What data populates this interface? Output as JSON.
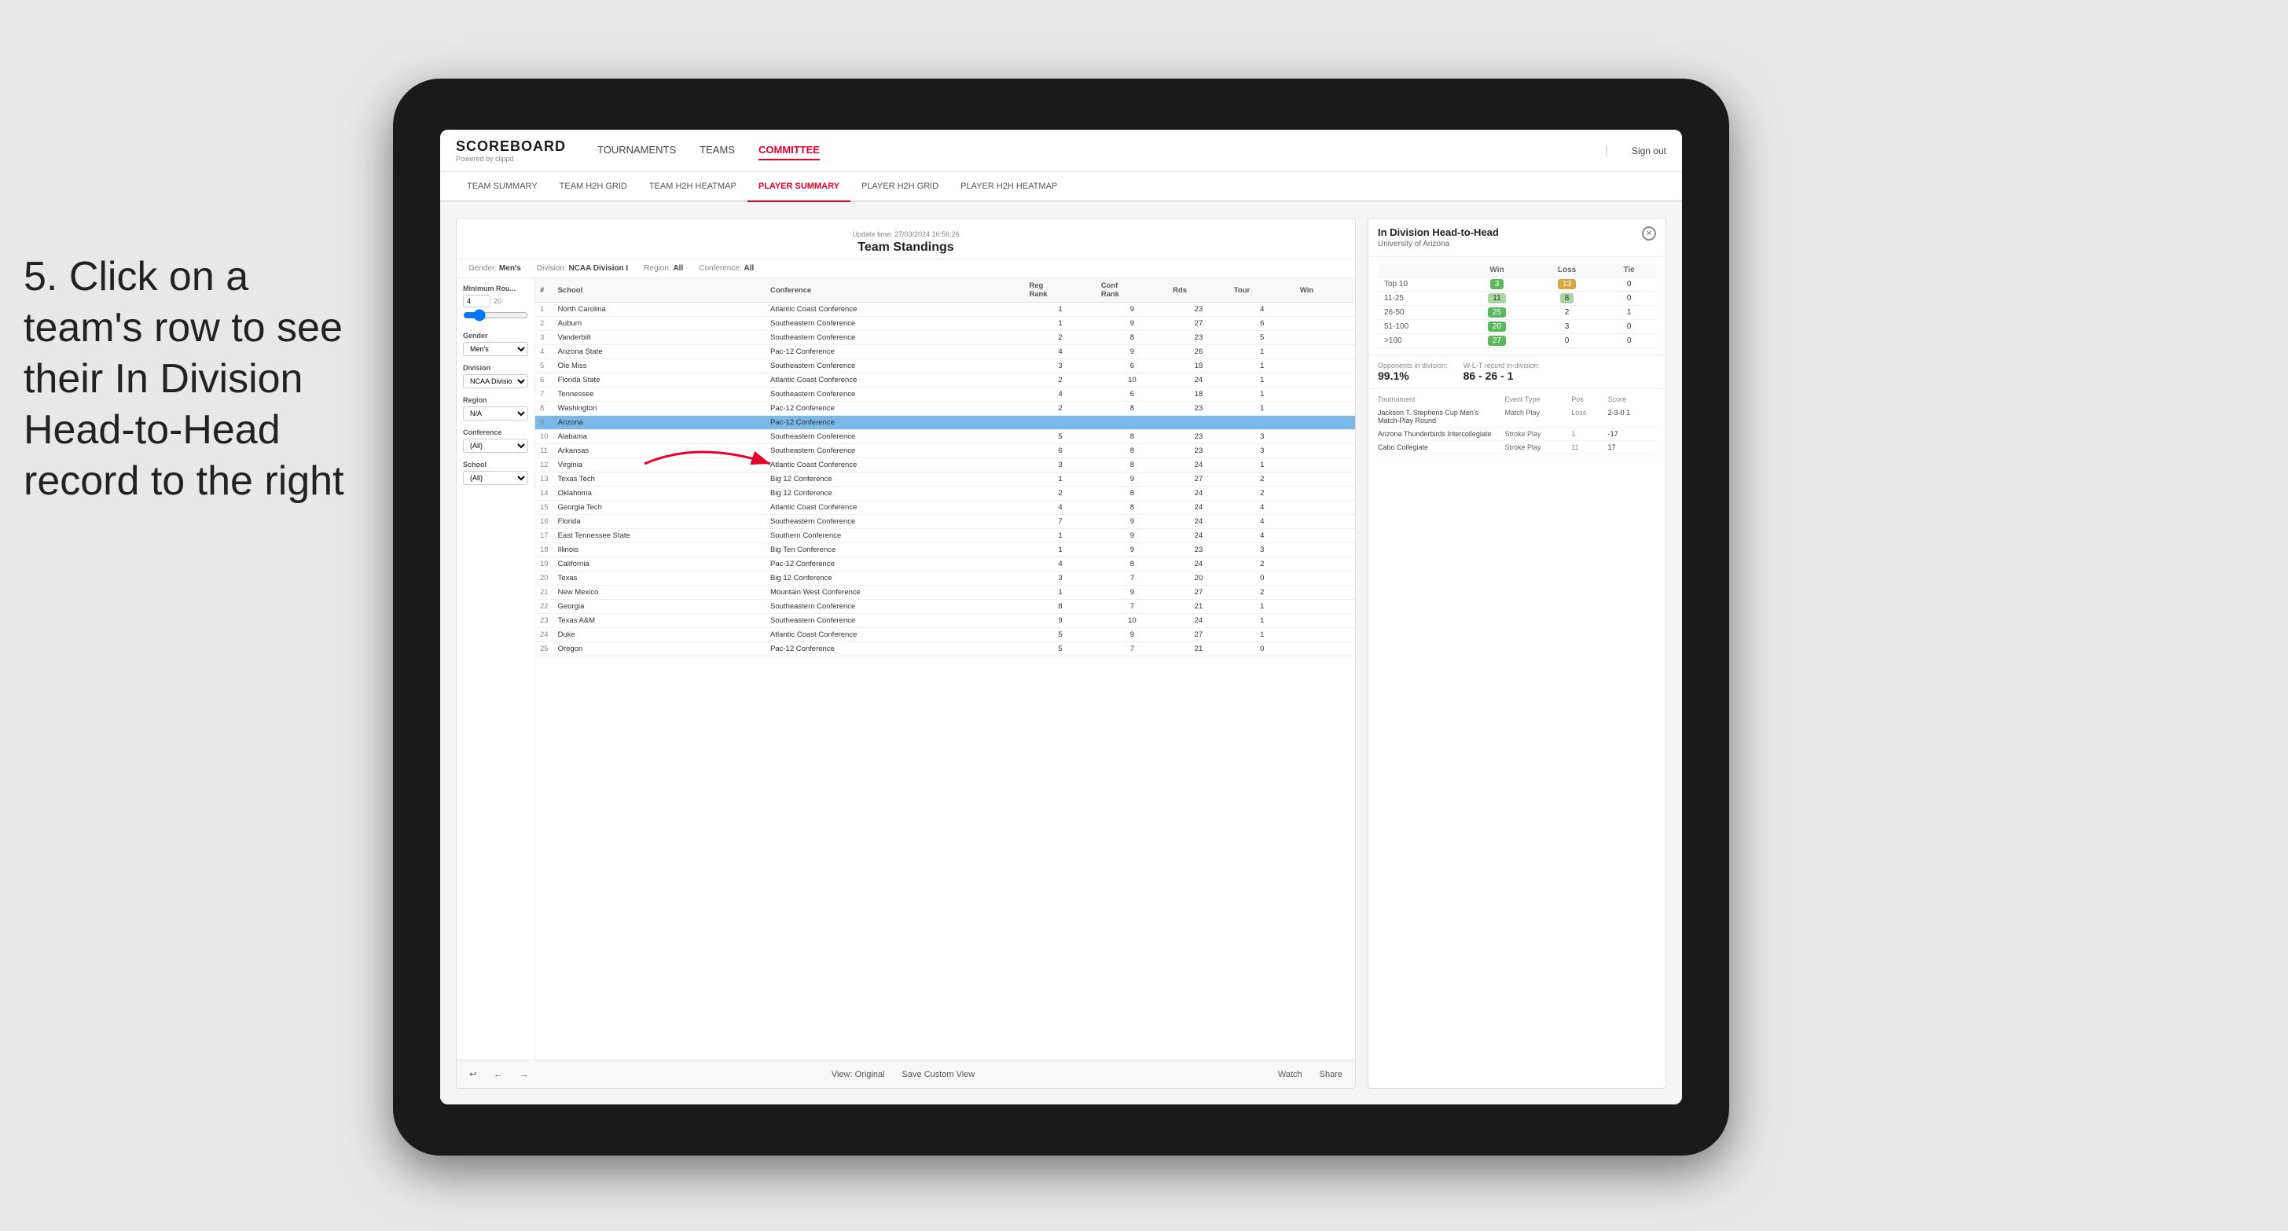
{
  "instruction": {
    "step": "5.",
    "text": "Click on a team's row to see their In Division Head-to-Head record to the right"
  },
  "nav": {
    "logo": "SCOREBOARD",
    "logo_sub": "Powered by clippd",
    "links": [
      "TOURNAMENTS",
      "TEAMS",
      "COMMITTEE"
    ],
    "active_link": "COMMITTEE",
    "sign_out": "Sign out"
  },
  "sub_nav": {
    "links": [
      "TEAM SUMMARY",
      "TEAM H2H GRID",
      "TEAM H2H HEATMAP",
      "PLAYER SUMMARY",
      "PLAYER H2H GRID",
      "PLAYER H2H HEATMAP"
    ],
    "active": "PLAYER SUMMARY"
  },
  "standings": {
    "title": "Team Standings",
    "update_time": "Update time:",
    "update_date": "27/03/2024 16:56:26",
    "filters": {
      "gender_label": "Gender:",
      "gender_val": "Men's",
      "division_label": "Division:",
      "division_val": "NCAA Division I",
      "region_label": "Region:",
      "region_val": "All",
      "conference_label": "Conference:",
      "conference_val": "All"
    },
    "sidebar": {
      "min_rounds_label": "Minimum Rou...",
      "min_rounds_val": "4",
      "min_rounds_max": "20",
      "gender_label": "Gender",
      "gender_val": "Men's",
      "division_label": "Division",
      "division_val": "NCAA Division I",
      "region_label": "Region",
      "region_val": "N/A",
      "conference_label": "Conference",
      "conference_val": "(All)",
      "school_label": "School",
      "school_val": "(All)"
    },
    "columns": [
      "#",
      "School",
      "Conference",
      "Reg Rank",
      "Conf Rank",
      "Rds",
      "Tour",
      "Win"
    ],
    "rows": [
      {
        "rank": 1,
        "school": "North Carolina",
        "conference": "Atlantic Coast Conference",
        "reg_rank": 1,
        "conf_rank": 9,
        "rds": 23,
        "tour": 4,
        "win": null
      },
      {
        "rank": 2,
        "school": "Auburn",
        "conference": "Southeastern Conference",
        "reg_rank": 1,
        "conf_rank": 9,
        "rds": 27,
        "tour": 6,
        "win": null
      },
      {
        "rank": 3,
        "school": "Vanderbilt",
        "conference": "Southeastern Conference",
        "reg_rank": 2,
        "conf_rank": 8,
        "rds": 23,
        "tour": 5,
        "win": null
      },
      {
        "rank": 4,
        "school": "Arizona State",
        "conference": "Pac-12 Conference",
        "reg_rank": 4,
        "conf_rank": 9,
        "rds": 26,
        "tour": 1,
        "win": null
      },
      {
        "rank": 5,
        "school": "Ole Miss",
        "conference": "Southeastern Conference",
        "reg_rank": 3,
        "conf_rank": 6,
        "rds": 18,
        "tour": 1,
        "win": null
      },
      {
        "rank": 6,
        "school": "Florida State",
        "conference": "Atlantic Coast Conference",
        "reg_rank": 2,
        "conf_rank": 10,
        "rds": 24,
        "tour": 1,
        "win": null
      },
      {
        "rank": 7,
        "school": "Tennessee",
        "conference": "Southeastern Conference",
        "reg_rank": 4,
        "conf_rank": 6,
        "rds": 18,
        "tour": 1,
        "win": null
      },
      {
        "rank": 8,
        "school": "Washington",
        "conference": "Pac-12 Conference",
        "reg_rank": 2,
        "conf_rank": 8,
        "rds": 23,
        "tour": 1,
        "win": null
      },
      {
        "rank": 9,
        "school": "Arizona",
        "conference": "Pac-12 Conference",
        "reg_rank": null,
        "conf_rank": null,
        "rds": null,
        "tour": null,
        "win": null,
        "selected": true
      },
      {
        "rank": 10,
        "school": "Alabama",
        "conference": "Southeastern Conference",
        "reg_rank": 5,
        "conf_rank": 8,
        "rds": 23,
        "tour": 3,
        "win": null
      },
      {
        "rank": 11,
        "school": "Arkansas",
        "conference": "Southeastern Conference",
        "reg_rank": 6,
        "conf_rank": 8,
        "rds": 23,
        "tour": 3,
        "win": null
      },
      {
        "rank": 12,
        "school": "Virginia",
        "conference": "Atlantic Coast Conference",
        "reg_rank": 3,
        "conf_rank": 8,
        "rds": 24,
        "tour": 1,
        "win": null
      },
      {
        "rank": 13,
        "school": "Texas Tech",
        "conference": "Big 12 Conference",
        "reg_rank": 1,
        "conf_rank": 9,
        "rds": 27,
        "tour": 2,
        "win": null
      },
      {
        "rank": 14,
        "school": "Oklahoma",
        "conference": "Big 12 Conference",
        "reg_rank": 2,
        "conf_rank": 8,
        "rds": 24,
        "tour": 2,
        "win": null
      },
      {
        "rank": 15,
        "school": "Georgia Tech",
        "conference": "Atlantic Coast Conference",
        "reg_rank": 4,
        "conf_rank": 8,
        "rds": 24,
        "tour": 4,
        "win": null
      },
      {
        "rank": 16,
        "school": "Florida",
        "conference": "Southeastern Conference",
        "reg_rank": 7,
        "conf_rank": 9,
        "rds": 24,
        "tour": 4,
        "win": null
      },
      {
        "rank": 17,
        "school": "East Tennessee State",
        "conference": "Southern Conference",
        "reg_rank": 1,
        "conf_rank": 9,
        "rds": 24,
        "tour": 4,
        "win": null
      },
      {
        "rank": 18,
        "school": "Illinois",
        "conference": "Big Ten Conference",
        "reg_rank": 1,
        "conf_rank": 9,
        "rds": 23,
        "tour": 3,
        "win": null
      },
      {
        "rank": 19,
        "school": "California",
        "conference": "Pac-12 Conference",
        "reg_rank": 4,
        "conf_rank": 8,
        "rds": 24,
        "tour": 2,
        "win": null
      },
      {
        "rank": 20,
        "school": "Texas",
        "conference": "Big 12 Conference",
        "reg_rank": 3,
        "conf_rank": 7,
        "rds": 20,
        "tour": 0,
        "win": null
      },
      {
        "rank": 21,
        "school": "New Mexico",
        "conference": "Mountain West Conference",
        "reg_rank": 1,
        "conf_rank": 9,
        "rds": 27,
        "tour": 2,
        "win": null
      },
      {
        "rank": 22,
        "school": "Georgia",
        "conference": "Southeastern Conference",
        "reg_rank": 8,
        "conf_rank": 7,
        "rds": 21,
        "tour": 1,
        "win": null
      },
      {
        "rank": 23,
        "school": "Texas A&M",
        "conference": "Southeastern Conference",
        "reg_rank": 9,
        "conf_rank": 10,
        "rds": 24,
        "tour": 1,
        "win": null
      },
      {
        "rank": 24,
        "school": "Duke",
        "conference": "Atlantic Coast Conference",
        "reg_rank": 5,
        "conf_rank": 9,
        "rds": 27,
        "tour": 1,
        "win": null
      },
      {
        "rank": 25,
        "school": "Oregon",
        "conference": "Pac-12 Conference",
        "reg_rank": 5,
        "conf_rank": 7,
        "rds": 21,
        "tour": 0,
        "win": null
      }
    ]
  },
  "h2h": {
    "title": "In Division Head-to-Head",
    "team": "University of Arizona",
    "close_icon": "×",
    "columns": [
      "",
      "Win",
      "Loss",
      "Tie"
    ],
    "rows": [
      {
        "label": "Top 10",
        "win": 3,
        "loss": 13,
        "tie": 0,
        "win_color": "green",
        "loss_color": "yellow"
      },
      {
        "label": "11-25",
        "win": 11,
        "loss": 8,
        "tie": 0,
        "win_color": "light_green",
        "loss_color": "light_green"
      },
      {
        "label": "26-50",
        "win": 25,
        "loss": 2,
        "tie": 1,
        "win_color": "green",
        "loss_color": ""
      },
      {
        "label": "51-100",
        "win": 20,
        "loss": 3,
        "tie": 0,
        "win_color": "green",
        "loss_color": ""
      },
      {
        "label": ">100",
        "win": 27,
        "loss": 0,
        "tie": 0,
        "win_color": "green",
        "loss_color": ""
      }
    ],
    "opponents_label": "Opponents in division:",
    "opponents_val": "99.1%",
    "record_label": "W-L-T record in-division:",
    "record_val": "86 - 26 - 1",
    "tournaments": [
      {
        "name": "Jackson T. Stephens Cup Men's Match-Play Round",
        "type": "Match Play",
        "result": "Loss",
        "score": "2-3-0 1"
      },
      {
        "name": "Arizona Thunderbirds Intercollegiate",
        "type": "Stroke Play",
        "result": "1",
        "score": "-17"
      },
      {
        "name": "Cabo Collegiate",
        "type": "Stroke Play",
        "result": "11",
        "score": "17"
      }
    ]
  },
  "toolbar": {
    "undo": "↩",
    "redo_back": "←",
    "redo_fwd": "→",
    "view_original": "View: Original",
    "save_custom": "Save Custom View",
    "watch": "Watch",
    "share": "Share"
  }
}
